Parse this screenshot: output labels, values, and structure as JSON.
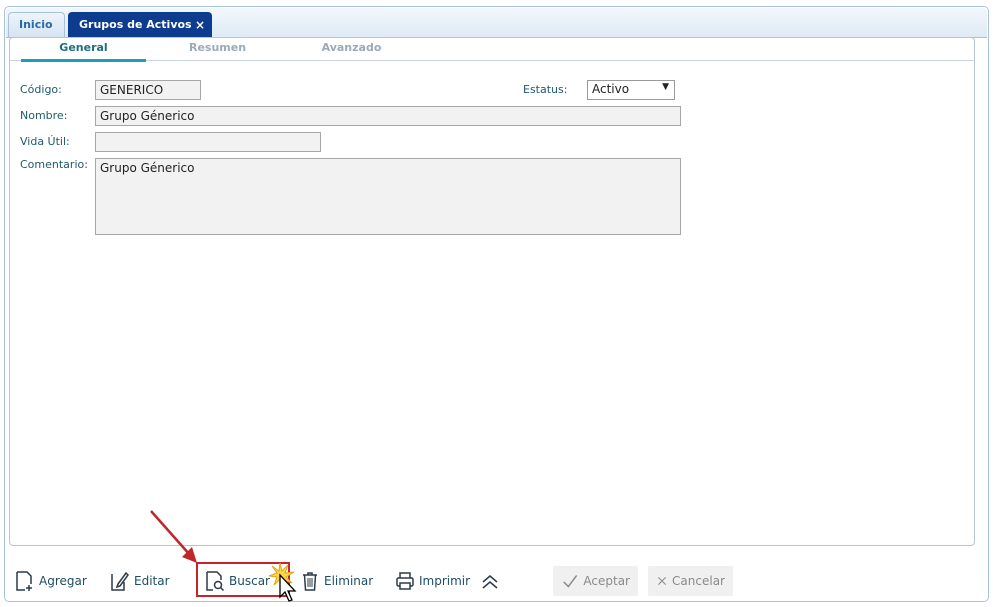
{
  "tabs": {
    "home": "Inicio",
    "current": "Grupos de Activos",
    "close": "×"
  },
  "subtabs": [
    "General",
    "Resumen",
    "Avanzado"
  ],
  "form": {
    "codigo_label": "Código:",
    "codigo_value": "GENERICO",
    "estatus_label": "Estatus:",
    "estatus_value": "Activo",
    "nombre_label": "Nombre:",
    "nombre_value": "Grupo Génerico",
    "vida_label": "Vida Útil:",
    "vida_value": "",
    "comentario_label": "Comentario:",
    "comentario_value": "Grupo Génerico"
  },
  "toolbar": {
    "agregar": "Agregar",
    "editar": "Editar",
    "buscar": "Buscar",
    "eliminar": "Eliminar",
    "imprimir": "Imprimir",
    "aceptar": "Aceptar",
    "cancelar": "Cancelar"
  },
  "colors": {
    "active_tab": "#0d3b8e",
    "accent": "#1ba0b8",
    "annotation": "#c0262c"
  }
}
